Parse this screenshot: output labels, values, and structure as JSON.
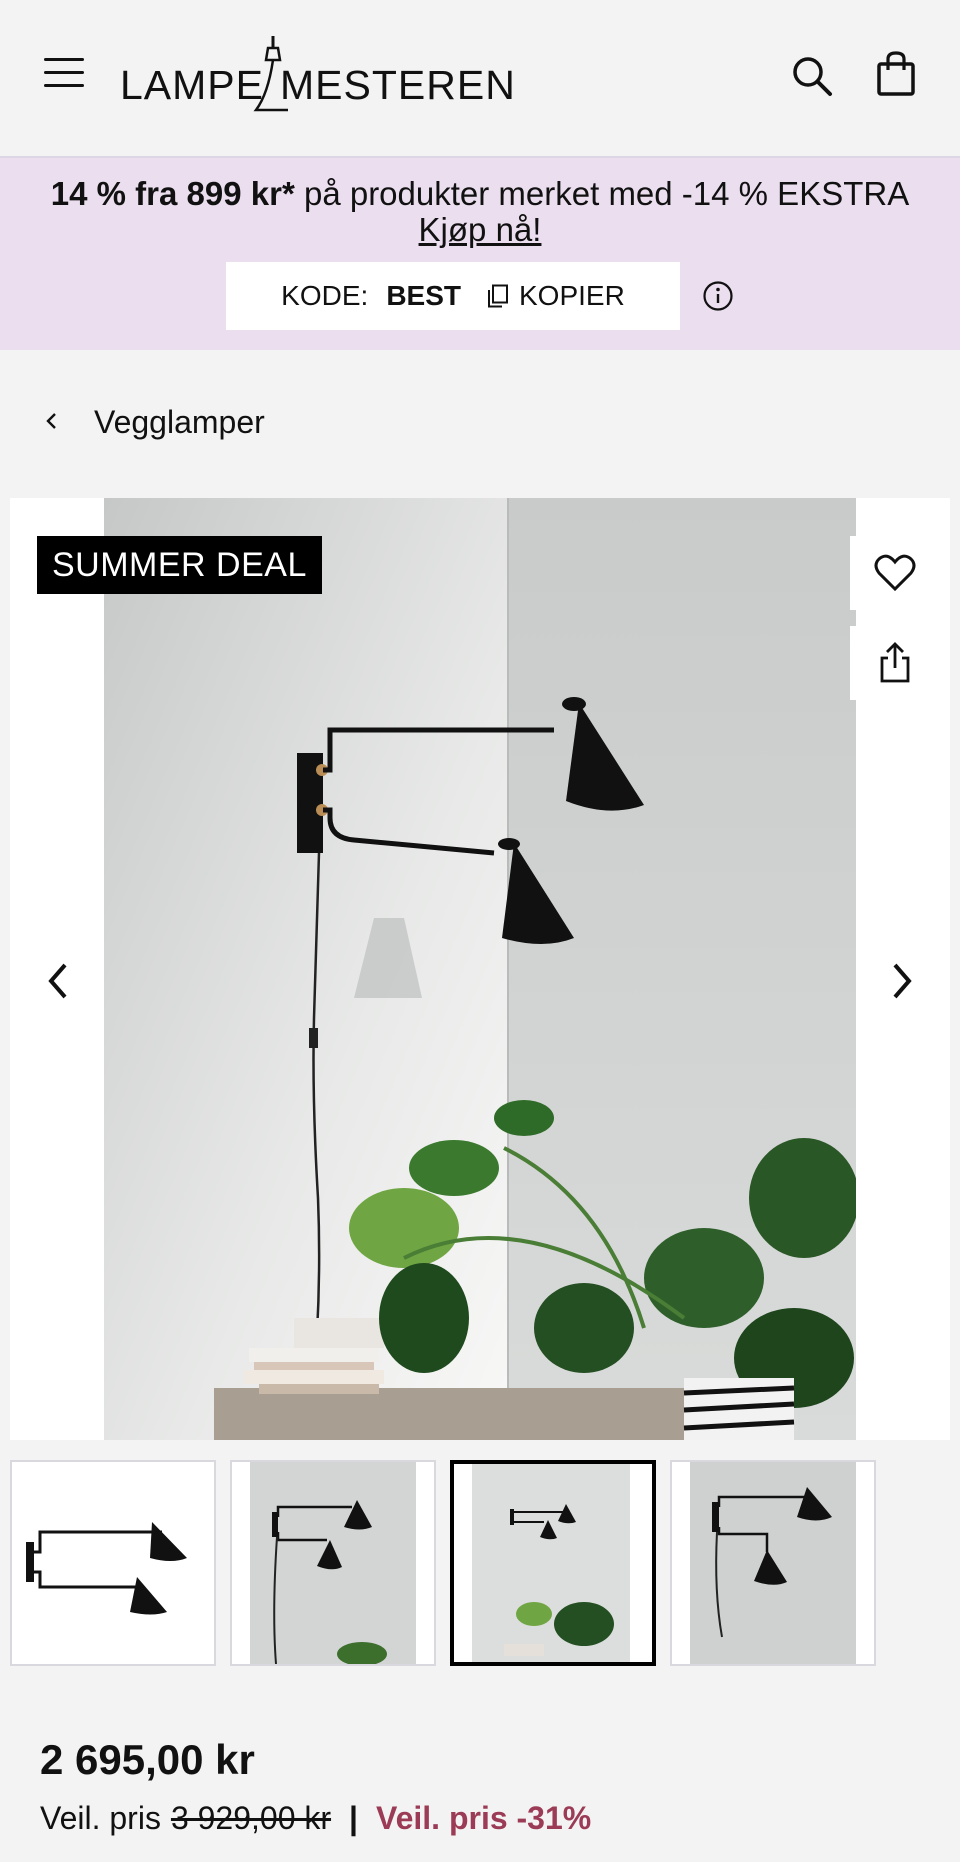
{
  "header": {
    "logo_left": "LAMPE",
    "logo_right": "MESTEREN",
    "menu_icon": "hamburger-menu-icon",
    "search_icon": "search-icon",
    "cart_icon": "shopping-bag-icon"
  },
  "promo": {
    "bold_part": "14 % fra 899 kr*",
    "normal_part": " på produkter merket med -14 % EKSTRA ",
    "cta": "Kjøp nå!",
    "code_label": "KODE:",
    "code_value": "BEST",
    "copy_label": "KOPIER",
    "background": "#ebdeef"
  },
  "breadcrumb": {
    "label": "Vegglamper"
  },
  "gallery": {
    "badge": "SUMMER DEAL",
    "favorite_icon": "heart-icon",
    "share_icon": "share-icon",
    "prev_icon": "chevron-left-icon",
    "next_icon": "chevron-right-icon",
    "thumbnail_count": 4,
    "active_thumbnail": 3
  },
  "pricing": {
    "price": "2 695,00 kr",
    "rec_label": "Veil. pris",
    "rec_price": "3 929,00 kr",
    "separator": "|",
    "discount": "Veil. pris -31%",
    "discount_color": "#9b3b55"
  }
}
